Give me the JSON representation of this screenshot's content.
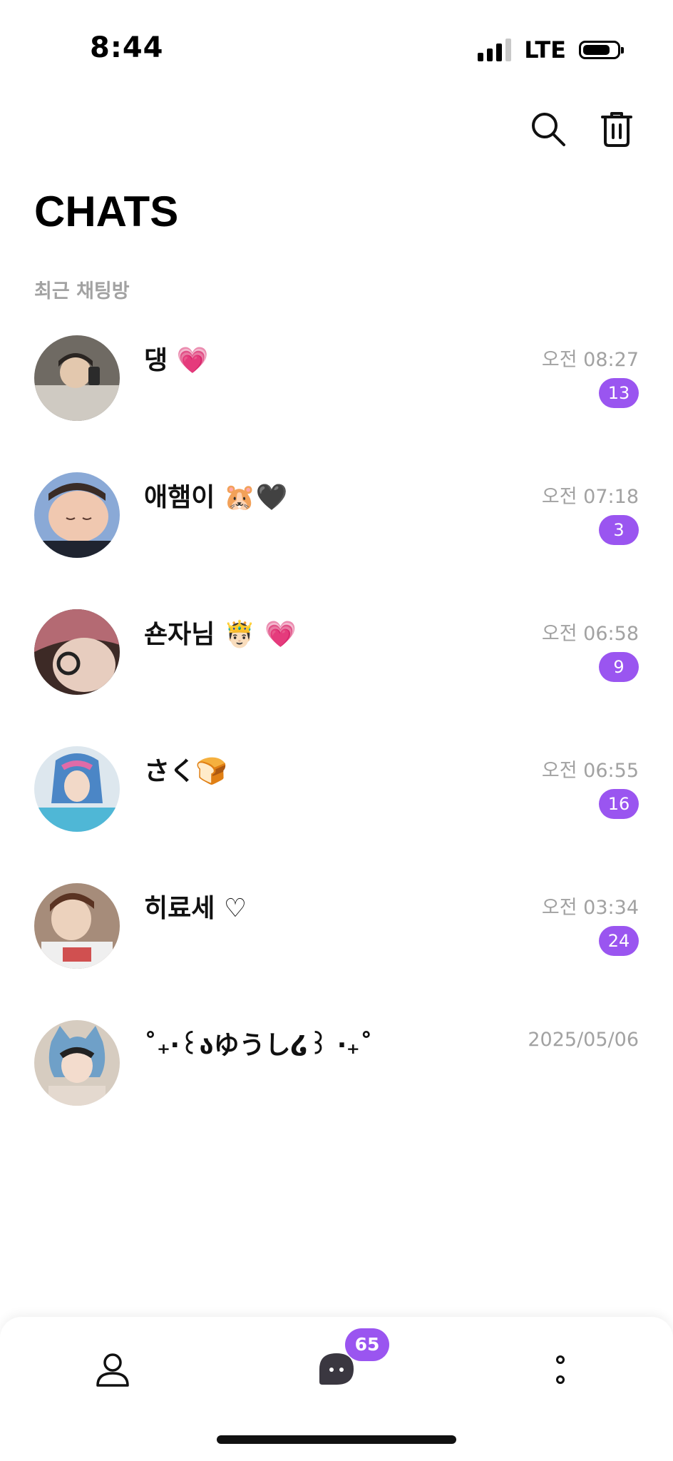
{
  "status_bar": {
    "time": "8:44",
    "network": "LTE",
    "signal_bars_active": 3,
    "battery_level": 0.8
  },
  "header": {
    "title": "CHATS",
    "actions": [
      {
        "icon": "search-icon"
      },
      {
        "icon": "trash-icon"
      }
    ]
  },
  "section": {
    "label": "최근 채팅방"
  },
  "chats": [
    {
      "name": "댕 💗",
      "time": "오전 08:27",
      "unread": "13"
    },
    {
      "name": "애햄이 🐹🖤",
      "time": "오전 07:18",
      "unread": "3"
    },
    {
      "name": "숀자님 🤴🏻 💗",
      "time": "오전 06:58",
      "unread": "9"
    },
    {
      "name": "さく🍞",
      "time": "오전 06:55",
      "unread": "16"
    },
    {
      "name": "히료세 ♡",
      "time": "오전 03:34",
      "unread": "24"
    },
    {
      "name": "˚₊‧꒰აゆうし໒꒱ ‧₊˚",
      "time": "2025/05/06",
      "unread": ""
    }
  ],
  "bottom_nav": {
    "items": [
      {
        "icon": "person-icon"
      },
      {
        "icon": "chat-bubble-icon",
        "badge": "65"
      },
      {
        "icon": "more-icon"
      }
    ]
  },
  "colors": {
    "accent": "#9a55f0",
    "muted_text": "#a2a2a2",
    "text": "#111111"
  }
}
